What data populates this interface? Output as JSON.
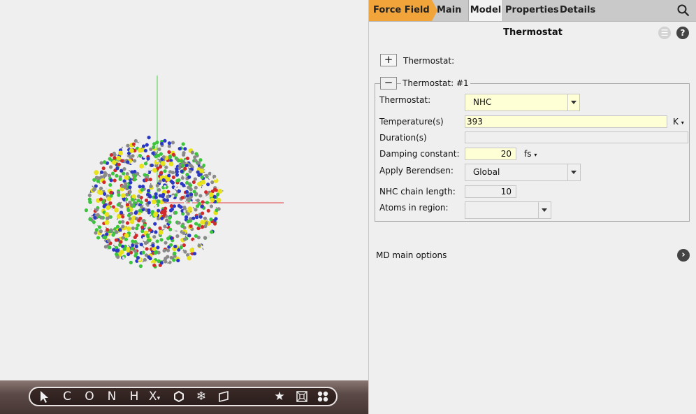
{
  "tabs": [
    {
      "label": "Force Field",
      "color": "#f1a43a"
    },
    {
      "label": "Main"
    },
    {
      "label": "Model",
      "active": true
    },
    {
      "label": "Properties"
    },
    {
      "label": "Details"
    }
  ],
  "panel": {
    "title": "Thermostat",
    "add_label": "Thermostat:",
    "group_label": "Thermostat: #1",
    "fields": {
      "thermostat": {
        "label": "Thermostat:",
        "value": "NHC"
      },
      "temperature": {
        "label": "Temperature(s)",
        "value": "393",
        "unit": "K"
      },
      "duration": {
        "label": "Duration(s)",
        "value": ""
      },
      "damping": {
        "label": "Damping constant:",
        "value": "20",
        "unit": "fs"
      },
      "berendsen": {
        "label": "Apply Berendsen:",
        "value": "Global"
      },
      "nhc_chain": {
        "label": "NHC chain length:",
        "value": "10"
      },
      "atoms_region": {
        "label": "Atoms in region:",
        "value": ""
      }
    },
    "md_main_options": "MD main options"
  },
  "toolbar": {
    "items": [
      "C",
      "O",
      "N",
      "H",
      "X"
    ]
  },
  "colors": {
    "atom_yellow": "#e8e21a",
    "atom_green": "#3cc43c",
    "atom_blue": "#2a38c4",
    "atom_red": "#d22a2a",
    "atom_gray": "#8a8a8a",
    "atom_white": "#e6e6e6"
  }
}
